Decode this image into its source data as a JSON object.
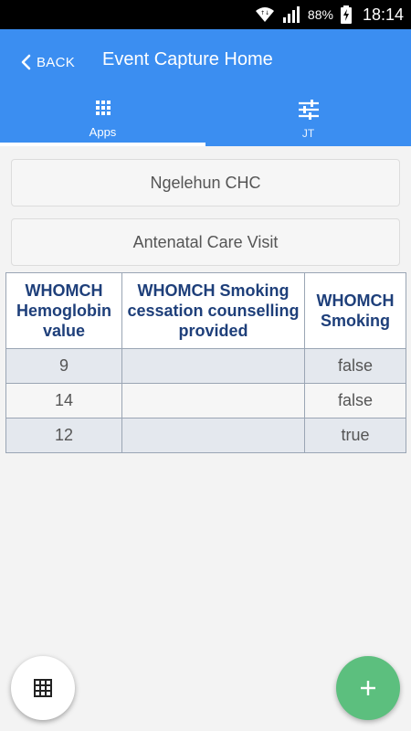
{
  "status_bar": {
    "battery": "88%",
    "time": "18:14"
  },
  "header": {
    "back_label": "BACK",
    "title": "Event Capture Home"
  },
  "tabs": [
    {
      "label": "Apps",
      "icon": "apps-grid-icon",
      "active": true
    },
    {
      "label": "JT",
      "icon": "sliders-icon",
      "active": false
    }
  ],
  "selectors": {
    "org_unit": "Ngelehun CHC",
    "program": "Antenatal Care Visit"
  },
  "table": {
    "headers": [
      "WHOMCH Hemoglobin value",
      "WHOMCH Smoking cessation counselling provided",
      "WHOMCH Smoking"
    ],
    "rows": [
      [
        "9",
        "",
        "false"
      ],
      [
        "14",
        "",
        "false"
      ],
      [
        "12",
        "",
        "true"
      ]
    ]
  },
  "fabs": {
    "left_icon": "table-grid-icon",
    "right_icon": "plus-icon"
  },
  "colors": {
    "primary": "#3b8ef1",
    "fab_green": "#5cbf7e",
    "header_text": "#1e3f7a"
  }
}
